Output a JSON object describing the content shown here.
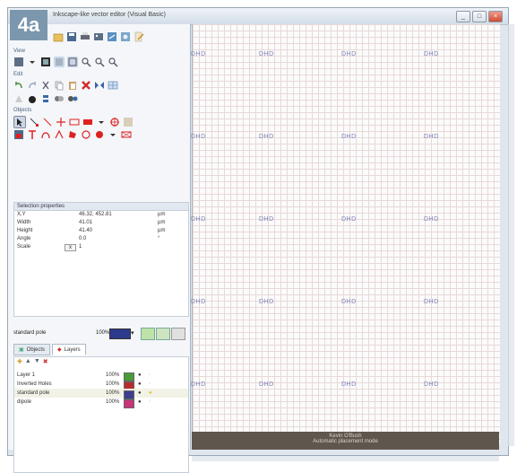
{
  "badge": "4a",
  "window": {
    "title": "Inkscape-like vector editor (Visual Basic)",
    "buttons": [
      "_",
      "□",
      "×"
    ]
  },
  "sections": {
    "view": "View",
    "edit": "Edit",
    "objects": "Objects"
  },
  "selection_properties": {
    "header": "Selection properties",
    "rows": [
      {
        "label": "X,Y",
        "value": "46.32, 452.81",
        "unit": "µm"
      },
      {
        "label": "Width",
        "value": "41.01",
        "unit": "µm"
      },
      {
        "label": "Height",
        "value": "41.40",
        "unit": "µm"
      },
      {
        "label": "Angle",
        "value": "0.0",
        "unit": "°"
      },
      {
        "label": "Scale",
        "value": "1",
        "unit": ""
      }
    ]
  },
  "stroke": {
    "label": "standard pole",
    "percent": "100%"
  },
  "tabs": [
    {
      "label": "Objects"
    },
    {
      "label": "Layers"
    }
  ],
  "layers": [
    {
      "name": "Layer 1",
      "percent": "100%",
      "color": "#4a9a3a"
    },
    {
      "name": "Inverted Holes",
      "percent": "100%",
      "color": "#b52e2e"
    },
    {
      "name": "standard pole",
      "percent": "100%",
      "color": "#3e3f8f"
    },
    {
      "name": "dipole",
      "percent": "100%",
      "color": "#c9347c"
    }
  ],
  "canvas": {
    "shape_text": "DHD",
    "rows": 5,
    "cols": 4
  },
  "status": {
    "line1": "Kevin O'Bush",
    "line2": "Automatic placement mode"
  }
}
